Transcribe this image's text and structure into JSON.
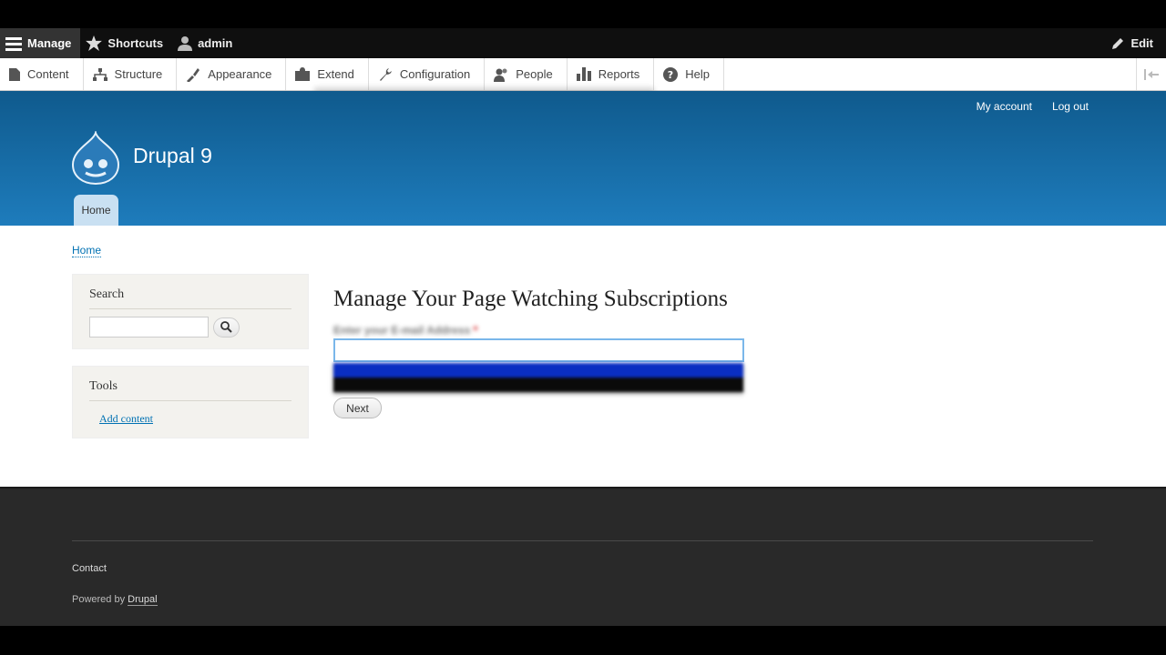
{
  "toolbar": {
    "manage_label": "Manage",
    "shortcuts_label": "Shortcuts",
    "user_label": "admin",
    "edit_label": "Edit"
  },
  "tray": {
    "items": [
      "Content",
      "Structure",
      "Appearance",
      "Extend",
      "Configuration",
      "People",
      "Reports",
      "Help"
    ]
  },
  "header": {
    "my_account": "My account",
    "log_out": "Log out",
    "site_name": "Drupal 9",
    "home_tab": "Home"
  },
  "breadcrumb": {
    "home": "Home"
  },
  "sidebar": {
    "search_title": "Search",
    "tools_title": "Tools",
    "add_content": "Add content"
  },
  "main": {
    "title": "Manage Your Page Watching Subscriptions",
    "field_label": "Enter your E-mail Address",
    "required_mark": "*",
    "next_button": "Next"
  },
  "footer": {
    "contact": "Contact",
    "powered_by": "Powered by",
    "drupal_link": "Drupal"
  },
  "colors": {
    "header_top": "#0f5a8d",
    "header_bottom": "#1e7cbc",
    "link": "#0071b3",
    "footer_bg": "#292929",
    "toolbar_bg": "#0f0f0f"
  }
}
